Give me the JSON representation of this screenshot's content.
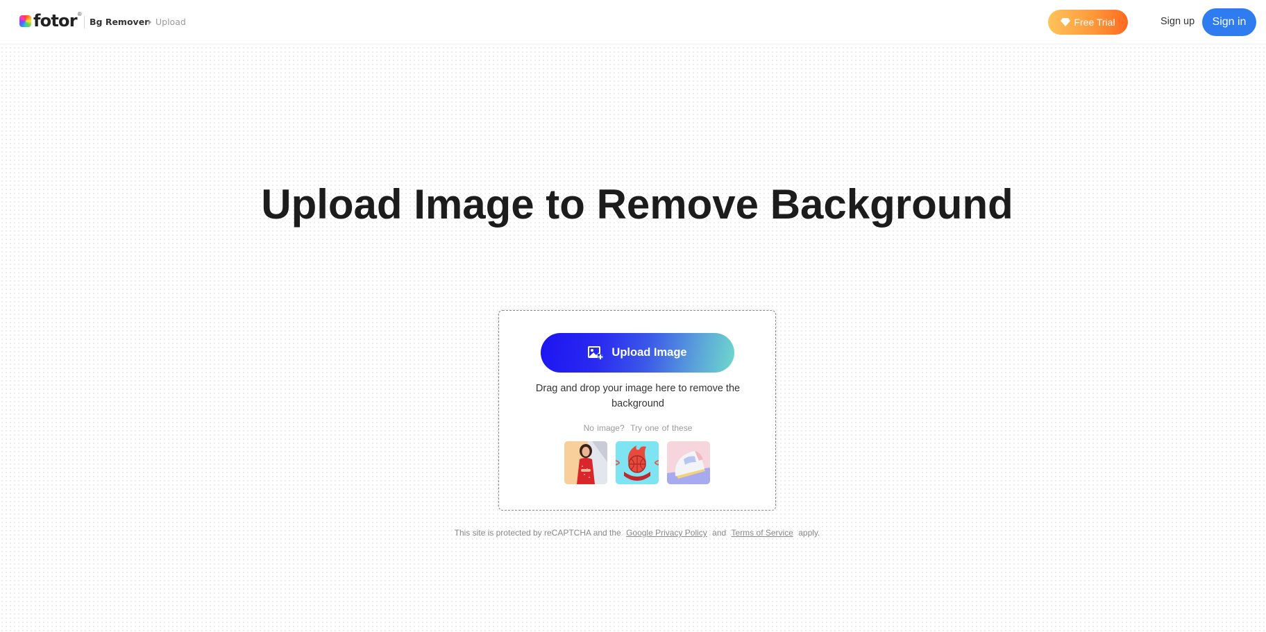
{
  "header": {
    "logo_text": "fotor",
    "logo_reg": "®",
    "breadcrumb": {
      "product": "Bg Remover",
      "current": "Upload"
    },
    "free_trial_label": "Free Trial",
    "sign_up_label": "Sign up",
    "sign_in_label": "Sign in",
    "icons": {
      "free_trial": "gem-icon",
      "breadcrumb_separator": "caret-right-icon"
    }
  },
  "main": {
    "title": "Upload Image to Remove Background",
    "upload": {
      "button_label": "Upload Image",
      "button_icon": "image-add-icon",
      "drop_hint": "Drag and drop your image here to remove the background",
      "try_label": "No image?  Try one of these",
      "samples": [
        {
          "name": "woman-in-red-dress",
          "alt": "Woman in red dress"
        },
        {
          "name": "basketball-logo",
          "alt": "Basketball logo"
        },
        {
          "name": "sneaker",
          "alt": "Sneaker"
        }
      ]
    }
  },
  "footer": {
    "legal_prefix": "This site is protected by reCAPTCHA and the",
    "privacy_link": "Google Privacy Policy",
    "legal_and": "and",
    "terms_link": "Terms of Service",
    "legal_suffix": "apply."
  },
  "colors": {
    "sign_in_bg": "#2f7bf0",
    "free_trial_gradient": [
      "#ffc35a",
      "#ff6a1f"
    ],
    "upload_gradient": [
      "#1d14f2",
      "#6ed9cc"
    ]
  }
}
